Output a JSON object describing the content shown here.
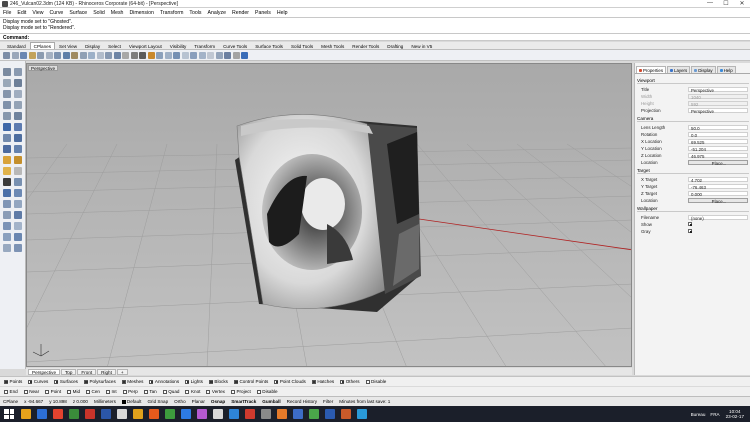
{
  "window": {
    "title": "246_Vulcan02.3dm (124 KB) - Rhinoceros Corporate (64-bit) - [Perspective]",
    "controls": [
      "—",
      "☐",
      "✕"
    ]
  },
  "menu": [
    "File",
    "Edit",
    "View",
    "Curve",
    "Surface",
    "Solid",
    "Mesh",
    "Dimension",
    "Transform",
    "Tools",
    "Analyze",
    "Render",
    "Panels",
    "Help"
  ],
  "history": [
    "Display mode set to \"Ghosted\".",
    "Display mode set to \"Rendered\"."
  ],
  "command_label": "Command:",
  "toolbar_tabs": [
    "Standard",
    "CPlanes",
    "Set View",
    "Display",
    "Select",
    "Viewport Layout",
    "Visibility",
    "Transform",
    "Curve Tools",
    "Surface Tools",
    "Solid Tools",
    "Mesh Tools",
    "Render Tools",
    "Drafting",
    "New in V5"
  ],
  "toolbar_tabs_active": 1,
  "viewport": {
    "label": "Perspective",
    "tabs": [
      "Perspective",
      "Top",
      "Front",
      "Right"
    ],
    "add_tab": "+"
  },
  "panel": {
    "tabs": [
      {
        "label": "Properties",
        "color": "#d34a2e"
      },
      {
        "label": "Layers",
        "color": "#3a74c9"
      },
      {
        "label": "Display",
        "color": "#6b9bd2"
      },
      {
        "label": "Help",
        "color": "#3c8bd9"
      }
    ],
    "viewport_section": "Viewport",
    "title_k": "Title",
    "title_v": "Perspective",
    "width_k": "Width",
    "width_v": "1040",
    "height_k": "Height",
    "height_v": "592",
    "projection_k": "Projection",
    "projection_v": "Perspective",
    "camera_section": "Camera",
    "lens_k": "Lens Length",
    "lens_v": "50.0",
    "rotation_k": "Rotation",
    "rotation_v": "0.0",
    "xloc_k": "X Location",
    "xloc_v": "69.525",
    "yloc_k": "Y Location",
    "yloc_v": "-51.204",
    "zloc_k": "Z Location",
    "zloc_v": "46.975",
    "loc_k": "Location",
    "place_label": "Place...",
    "target_section": "Target",
    "xt_k": "X Target",
    "xt_v": "4.702",
    "yt_k": "Y Target",
    "yt_v": "-76.463",
    "zt_k": "Z Target",
    "zt_v": "0.000",
    "tloc_k": "Location",
    "wallpaper_section": "Wallpaper",
    "filename_k": "Filename",
    "filename_v": "(none)",
    "show_k": "Show",
    "gray_k": "Gray"
  },
  "osnap_row1": [
    "Points",
    "Curves",
    "Surfaces",
    "Polysurfaces",
    "Meshes",
    "Annotations",
    "Lights",
    "Blocks",
    "Control Points",
    "Point Clouds",
    "Hatches",
    "Others",
    "Disable"
  ],
  "osnap_row2": [
    "End",
    "Near",
    "Point",
    "Mid",
    "Cen",
    "Int",
    "Perp",
    "Tan",
    "Quad",
    "Knot",
    "Vertex",
    "Project",
    "Disable"
  ],
  "status": {
    "cplane": "CPlane",
    "x": "x -94.667",
    "y": "y 10.898",
    "z": "z 0.000",
    "units": "Millimeters",
    "layer": "Default",
    "toggles": [
      "Grid Snap",
      "Ortho",
      "Planar",
      "Osnap",
      "SmartTrack",
      "Gumball",
      "Record History",
      "Filter"
    ],
    "bold_toggles": [
      "Osnap",
      "SmartTrack",
      "Gumball"
    ],
    "message": "Minutes from last save: 1"
  },
  "taskbar": {
    "icons": [
      "#e7a21b",
      "#2d6fd6",
      "#e3432f",
      "#3a8b3a",
      "#c9342a",
      "#2b56a8",
      "#d9d9d9",
      "#e0a11c",
      "#e65a1c",
      "#3d9b3d",
      "#2d7be5",
      "#b45ad1",
      "#d9d9d9",
      "#2e84d8",
      "#cf3a2e",
      "#8a8a8a",
      "#e57a2a",
      "#3d6cc7",
      "#4aa64a",
      "#2b5bb0",
      "#c85a2a",
      "#2a9ad8"
    ],
    "weather": "Bureau",
    "lang": "FRA",
    "time": "10:04",
    "date": "23-02-17"
  }
}
